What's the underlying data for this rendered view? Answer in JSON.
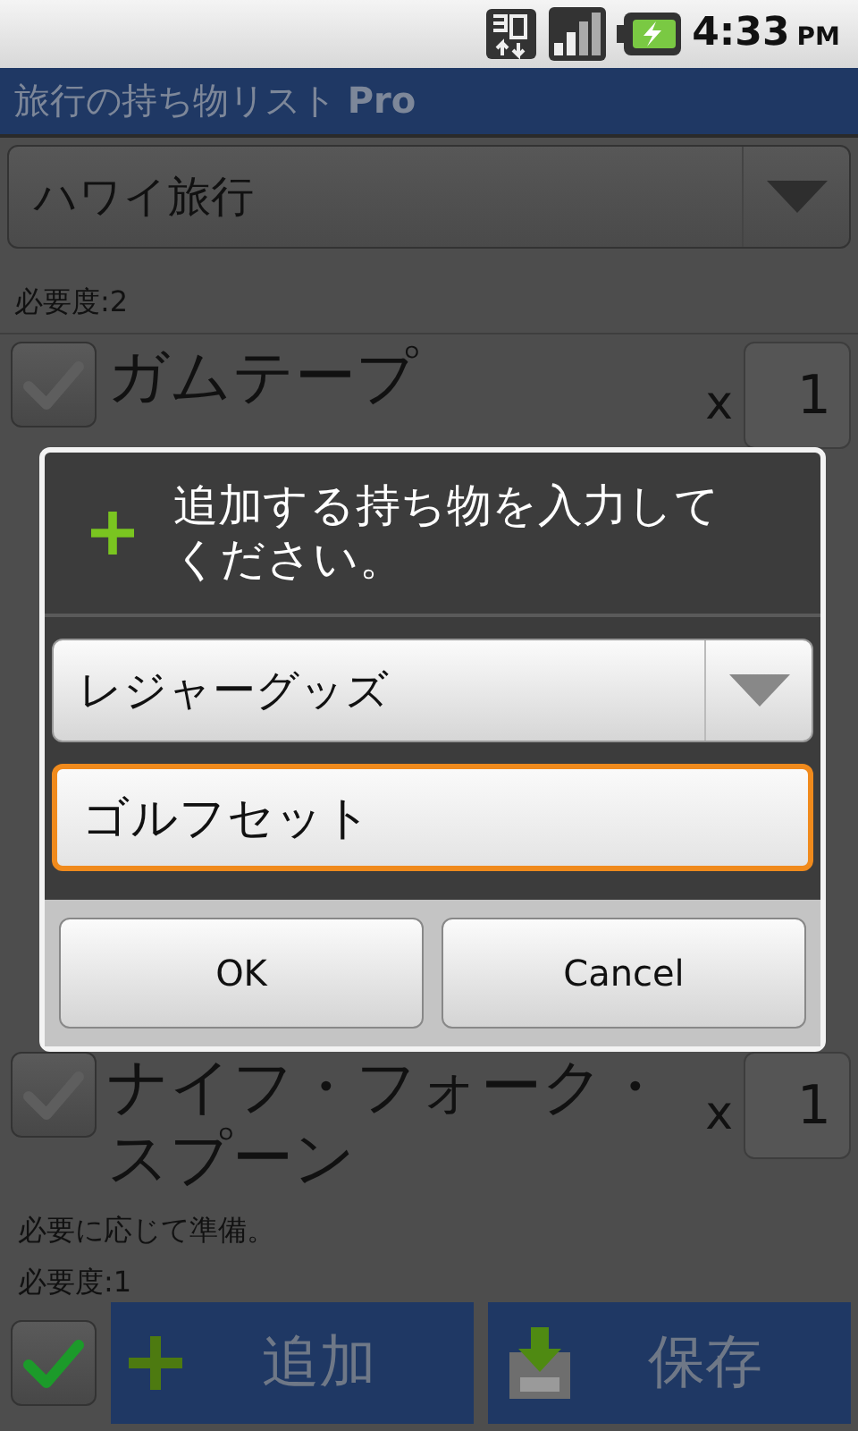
{
  "status_bar": {
    "time": "4:33",
    "ampm": "PM"
  },
  "app_bar": {
    "title": "旅行の持ち物リスト **Pro**"
  },
  "trip_selector": {
    "value": "ハワイ旅行"
  },
  "list": {
    "top_caption": "必要度:2",
    "items": [
      {
        "name": "ガムテープ",
        "checked": false,
        "times": "x",
        "quantity": "1"
      },
      {
        "name": "ナイフ・フォーク・スプーン",
        "checked": false,
        "times": "x",
        "quantity": "1",
        "note": "必要に応じて準備。",
        "priority": "必要度:1"
      }
    ]
  },
  "bottom_bar": {
    "all_checked": true,
    "add_button": "追加",
    "save_button": "保存"
  },
  "dialog": {
    "title": "追加する持ち物を入力してください。",
    "category": "レジャーグッズ",
    "item_input": {
      "value": "ゴルフセット",
      "focused": true
    },
    "buttons": [
      "OK",
      "Cancel"
    ]
  }
}
